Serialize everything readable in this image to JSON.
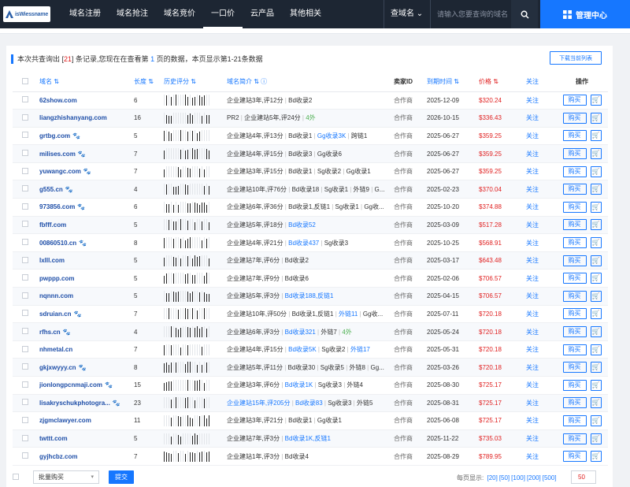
{
  "header": {
    "logo_text": "isWiessname",
    "nav": [
      "域名注册",
      "域名抢注",
      "域名竞价",
      "一口价",
      "云产品",
      "其他相关"
    ],
    "active_nav": 3,
    "search_type": "查域名",
    "search_placeholder": "请输入您要查询的域名",
    "admin_label": "管理中心"
  },
  "summary": {
    "prefix": "本次共查询出 [",
    "count": "21",
    "mid": "] 条记录,您现在在查看第",
    "page": "1",
    "suffix": "页的数据，本页显示第1-21条数据"
  },
  "export_label": "下载当前列表",
  "columns": {
    "domain": "域名",
    "length": "长度",
    "history": "历史评分",
    "intro": "域名简介",
    "seller": "卖家ID",
    "expire": "到期时间",
    "price": "价格",
    "follow": "关注",
    "action": "操作"
  },
  "buy_label": "购买",
  "rows": [
    {
      "domain": "62show.com",
      "paw": false,
      "length": "6",
      "intro": [
        [
          "企业建站3年,评12分",
          ""
        ],
        [
          "Bd收录2",
          ""
        ]
      ],
      "seller": "合作商",
      "expire": "2025-12-09",
      "price": "$320.24",
      "follow": "关注"
    },
    {
      "domain": "liangzhishanyang.com",
      "paw": false,
      "length": "16",
      "intro": [
        [
          "PR2",
          ""
        ],
        [
          "企业建站5年,评24分",
          ""
        ],
        [
          "4外",
          "gr"
        ]
      ],
      "seller": "合作商",
      "expire": "2026-10-15",
      "price": "$336.43",
      "follow": "关注"
    },
    {
      "domain": "grtbg.com",
      "paw": true,
      "length": "5",
      "intro": [
        [
          "企业建站4年,评13分",
          ""
        ],
        [
          "Bd收录1",
          ""
        ],
        [
          "Gg收录3K",
          "lk"
        ],
        [
          "跨链1",
          ""
        ]
      ],
      "seller": "合作商",
      "expire": "2025-06-27",
      "price": "$359.25",
      "follow": "关注"
    },
    {
      "domain": "milises.com",
      "paw": true,
      "length": "7",
      "intro": [
        [
          "企业建站4年,评15分",
          ""
        ],
        [
          "Bd收录3",
          ""
        ],
        [
          "Gg收录6",
          ""
        ]
      ],
      "seller": "合作商",
      "expire": "2025-06-27",
      "price": "$359.25",
      "follow": "关注"
    },
    {
      "domain": "yuwangc.com",
      "paw": true,
      "length": "7",
      "intro": [
        [
          "企业建站3年,评15分",
          ""
        ],
        [
          "Bd收录1",
          ""
        ],
        [
          "Sg收录2",
          ""
        ],
        [
          "Gg收录1",
          ""
        ]
      ],
      "seller": "合作商",
      "expire": "2025-06-27",
      "price": "$359.25",
      "follow": "关注"
    },
    {
      "domain": "g555.cn",
      "paw": true,
      "length": "4",
      "intro": [
        [
          "企业建站10年,评76分",
          ""
        ],
        [
          "Bd收录18",
          ""
        ],
        [
          "Sg收录1",
          ""
        ],
        [
          "外链9",
          ""
        ],
        [
          "G...",
          ""
        ]
      ],
      "seller": "合作商",
      "expire": "2025-02-23",
      "price": "$370.04",
      "follow": "关注"
    },
    {
      "domain": "973856.com",
      "paw": true,
      "length": "6",
      "intro": [
        [
          "企业建站6年,评36分",
          ""
        ],
        [
          "Bd收录1,反链1",
          ""
        ],
        [
          "Sg收录1",
          ""
        ],
        [
          "Gg收...",
          ""
        ]
      ],
      "seller": "合作商",
      "expire": "2025-10-20",
      "price": "$374.88",
      "follow": "关注"
    },
    {
      "domain": "fbfff.com",
      "paw": false,
      "length": "5",
      "intro": [
        [
          "企业建站5年,评18分",
          ""
        ],
        [
          "Bd收录52",
          "lk"
        ]
      ],
      "seller": "合作商",
      "expire": "2025-03-09",
      "price": "$517.28",
      "follow": "关注"
    },
    {
      "domain": "00860510.cn",
      "paw": true,
      "length": "8",
      "intro": [
        [
          "企业建站4年,评21分",
          ""
        ],
        [
          "Bd收录437",
          "lk"
        ],
        [
          "Sg收录3",
          ""
        ]
      ],
      "seller": "合作商",
      "expire": "2025-10-25",
      "price": "$568.91",
      "follow": "关注"
    },
    {
      "domain": "lxlll.com",
      "paw": false,
      "length": "5",
      "intro": [
        [
          "企业建站7年,评6分",
          ""
        ],
        [
          "Bd收录2",
          ""
        ]
      ],
      "seller": "合作商",
      "expire": "2025-03-17",
      "price": "$643.48",
      "follow": "关注"
    },
    {
      "domain": "pwppp.com",
      "paw": false,
      "length": "5",
      "intro": [
        [
          "企业建站7年,评9分",
          ""
        ],
        [
          "Bd收录6",
          ""
        ]
      ],
      "seller": "合作商",
      "expire": "2025-02-06",
      "price": "$706.57",
      "follow": "关注"
    },
    {
      "domain": "nqnnn.com",
      "paw": false,
      "length": "5",
      "intro": [
        [
          "企业建站5年,评3分",
          ""
        ],
        [
          "Bd收录188,反链1",
          "lk"
        ]
      ],
      "seller": "合作商",
      "expire": "2025-04-15",
      "price": "$706.57",
      "follow": "关注"
    },
    {
      "domain": "sdruian.cn",
      "paw": true,
      "length": "7",
      "intro": [
        [
          "企业建站10年,评50分",
          ""
        ],
        [
          "Bd收录1,反链1",
          ""
        ],
        [
          "外链11",
          "lk"
        ],
        [
          "Gg收...",
          ""
        ]
      ],
      "seller": "合作商",
      "expire": "2025-07-11",
      "price": "$720.18",
      "follow": "关注"
    },
    {
      "domain": "rfhs.cn",
      "paw": true,
      "length": "4",
      "intro": [
        [
          "企业建站6年,评3分",
          ""
        ],
        [
          "Bd收录321",
          "lk"
        ],
        [
          "外链7",
          ""
        ],
        [
          "4外",
          "gr"
        ]
      ],
      "seller": "合作商",
      "expire": "2025-05-24",
      "price": "$720.18",
      "follow": "关注"
    },
    {
      "domain": "nhmetal.cn",
      "paw": false,
      "length": "7",
      "intro": [
        [
          "企业建站4年,评15分",
          ""
        ],
        [
          "Bd收录5K",
          "lk"
        ],
        [
          "Sg收录2",
          ""
        ],
        [
          "外链17",
          "lk"
        ]
      ],
      "seller": "合作商",
      "expire": "2025-05-31",
      "price": "$720.18",
      "follow": "关注"
    },
    {
      "domain": "gkjxwyyy.cn",
      "paw": true,
      "length": "8",
      "intro": [
        [
          "企业建站5年,评11分",
          ""
        ],
        [
          "Bd收录30",
          ""
        ],
        [
          "Sg收录5",
          ""
        ],
        [
          "外链8",
          ""
        ],
        [
          "Gg...",
          ""
        ]
      ],
      "seller": "合作商",
      "expire": "2025-03-26",
      "price": "$720.18",
      "follow": "关注"
    },
    {
      "domain": "jionlongpcnmaji.com",
      "paw": true,
      "length": "15",
      "intro": [
        [
          "企业建站3年,评6分",
          ""
        ],
        [
          "Bd收录1K",
          "lk"
        ],
        [
          "Sg收录3",
          ""
        ],
        [
          "外链4",
          ""
        ]
      ],
      "seller": "合作商",
      "expire": "2025-08-30",
      "price": "$725.17",
      "follow": "关注"
    },
    {
      "domain": "lisakryschukphotogra...",
      "paw": true,
      "length": "23",
      "intro": [
        [
          "企业建站15年,评205分",
          "lk"
        ],
        [
          "Bd收录83",
          "lk"
        ],
        [
          "Sg收录3",
          ""
        ],
        [
          "外链5",
          ""
        ]
      ],
      "seller": "合作商",
      "expire": "2025-08-31",
      "price": "$725.17",
      "follow": "关注"
    },
    {
      "domain": "zjgmclawyer.com",
      "paw": false,
      "length": "11",
      "intro": [
        [
          "企业建站3年,评21分",
          ""
        ],
        [
          "Bd收录1",
          ""
        ],
        [
          "Gg收录1",
          ""
        ]
      ],
      "seller": "合作商",
      "expire": "2025-06-08",
      "price": "$725.17",
      "follow": "关注"
    },
    {
      "domain": "twttt.com",
      "paw": false,
      "length": "5",
      "intro": [
        [
          "企业建站7年,评3分",
          ""
        ],
        [
          "Bd收录1K,反链1",
          "lk"
        ]
      ],
      "seller": "合作商",
      "expire": "2025-11-22",
      "price": "$735.03",
      "follow": "关注"
    },
    {
      "domain": "gyjhcbz.com",
      "paw": false,
      "length": "7",
      "intro": [
        [
          "企业建站1年,评3分",
          ""
        ],
        [
          "Bd收录4",
          ""
        ]
      ],
      "seller": "合作商",
      "expire": "2025-08-29",
      "price": "$789.95",
      "follow": "关注"
    }
  ],
  "footer": {
    "bulk_label": "批量购买",
    "submit_label": "提交",
    "perpage_prefix": "每页显示:",
    "perpage_options": [
      "[20]",
      "[50]",
      "[100]",
      "[200]",
      "[500]"
    ],
    "perpage_value": "50"
  },
  "colors": {
    "accent": "#1677ff",
    "price": "#e02020",
    "topbar": "#1d2633"
  }
}
